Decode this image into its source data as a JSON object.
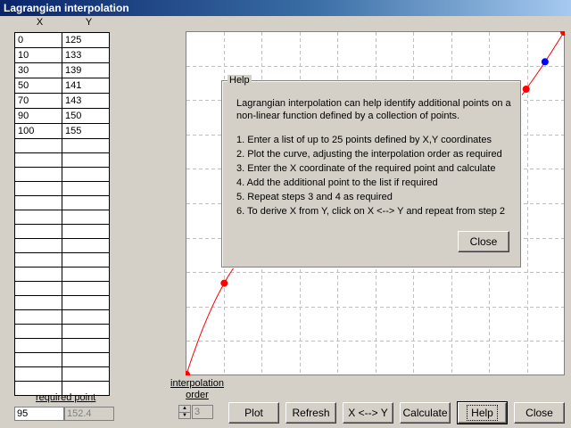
{
  "window": {
    "title": "Lagrangian interpolation"
  },
  "table": {
    "headers": {
      "x": "X",
      "y": "Y"
    },
    "rows": [
      [
        "0",
        "125"
      ],
      [
        "10",
        "133"
      ],
      [
        "30",
        "139"
      ],
      [
        "50",
        "141"
      ],
      [
        "70",
        "143"
      ],
      [
        "90",
        "150"
      ],
      [
        "100",
        "155"
      ],
      [
        "",
        ""
      ],
      [
        "",
        ""
      ],
      [
        "",
        ""
      ],
      [
        "",
        ""
      ],
      [
        "",
        ""
      ],
      [
        "",
        ""
      ],
      [
        "",
        ""
      ],
      [
        "",
        ""
      ],
      [
        "",
        ""
      ],
      [
        "",
        ""
      ],
      [
        "",
        ""
      ],
      [
        "",
        ""
      ],
      [
        "",
        ""
      ],
      [
        "",
        ""
      ],
      [
        "",
        ""
      ],
      [
        "",
        ""
      ],
      [
        "",
        ""
      ],
      [
        "",
        ""
      ]
    ]
  },
  "required_point": {
    "label": "required point",
    "x_value": "95",
    "y_value": "152.4"
  },
  "interpolation_order": {
    "label_line1": "interpolation",
    "label_line2": "order",
    "value": "3"
  },
  "buttons": {
    "plot": "Plot",
    "refresh": "Refresh",
    "swap": "X <--> Y",
    "calculate": "Calculate",
    "help": "Help",
    "close": "Close"
  },
  "help_dialog": {
    "title": "Help",
    "intro": "Lagrangian interpolation can help identify additional points on a non-linear function defined by a collection of points.",
    "steps": [
      "1. Enter a list of up to 25 points defined by X,Y coordinates",
      "2. Plot the curve, adjusting the interpolation order as required",
      "3. Enter the X coordinate of the required point and calculate",
      "4. Add the additional point to the list if required",
      "5. Repeat steps 3 and 4 as required",
      "6. To derive X from Y, click on X <--> Y and repeat from step 2"
    ],
    "close_label": "Close"
  },
  "chart_data": {
    "type": "scatter",
    "points": [
      [
        0,
        125
      ],
      [
        10,
        133
      ],
      [
        30,
        139
      ],
      [
        50,
        141
      ],
      [
        70,
        143
      ],
      [
        90,
        150
      ],
      [
        100,
        155
      ]
    ],
    "required_point": [
      95,
      152.4
    ],
    "xlim": [
      0,
      100
    ],
    "ylim": [
      125,
      155
    ],
    "grid": true,
    "colors": {
      "points": "#ff0000",
      "curve": "#ff0000",
      "required": "#0000ff",
      "grid": "#c0c0c0"
    }
  }
}
